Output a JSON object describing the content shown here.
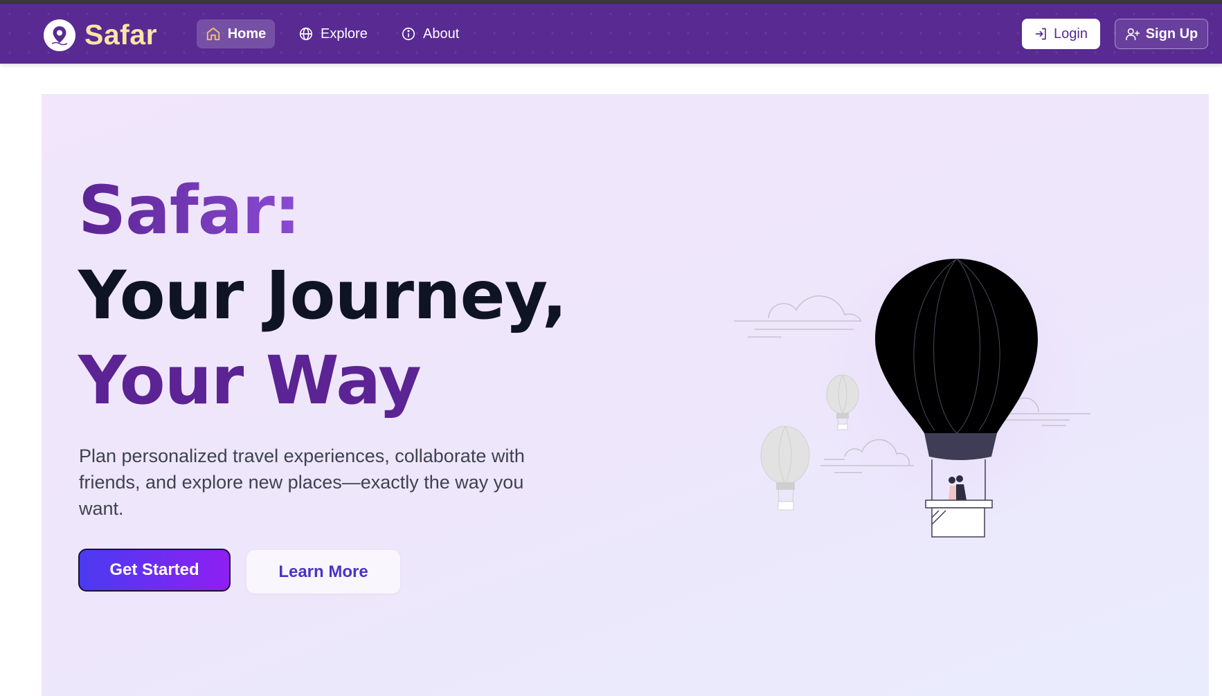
{
  "nav": {
    "brand": "Safar",
    "items": [
      {
        "label": "Home",
        "icon": "home-icon",
        "active": true
      },
      {
        "label": "Explore",
        "icon": "globe-icon"
      },
      {
        "label": "About",
        "icon": "info-icon"
      }
    ],
    "login_label": "Login",
    "signup_label": "Sign Up"
  },
  "hero": {
    "title_line1": "Safar:",
    "title_line2": "Your Journey,",
    "title_line3": "Your Way",
    "subtitle": "Plan personalized travel experiences, collaborate with friends, and explore new places—exactly the way you want.",
    "primary_cta": "Get Started",
    "secondary_cta": "Learn More"
  },
  "colors": {
    "navbar": "#582a92",
    "brand_text": "#fde5a6",
    "home_icon": "#f7c66a",
    "title_purple": "#5b2393",
    "title_dark": "#0f1424",
    "cta_gradient_start": "#4a3bf0",
    "cta_gradient_end": "#8f1ff2",
    "secondary_cta_text": "#4a32c8",
    "hero_background": "#efe6fb"
  },
  "icons": [
    "map-pin-icon",
    "home-icon",
    "globe-icon",
    "info-icon",
    "login-icon",
    "user-plus-icon"
  ]
}
